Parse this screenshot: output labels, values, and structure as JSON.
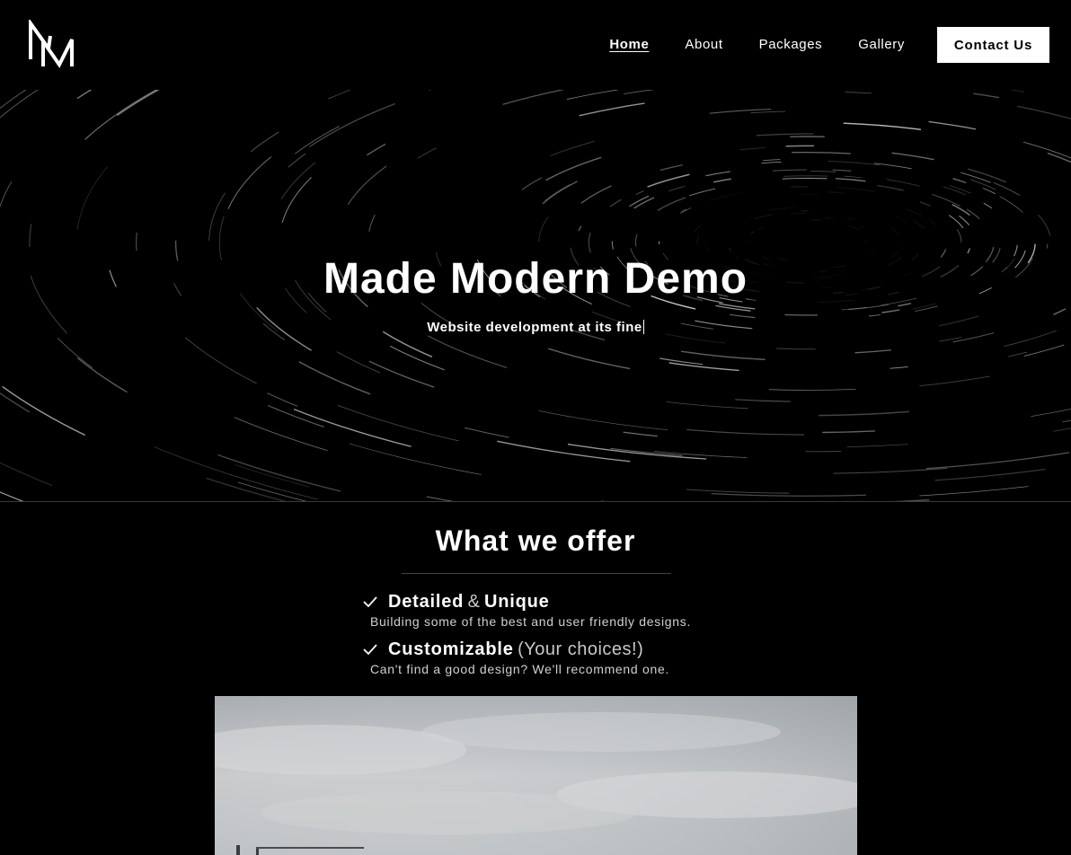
{
  "nav": {
    "links": [
      {
        "label": "Home"
      },
      {
        "label": "About"
      },
      {
        "label": "Packages"
      },
      {
        "label": "Gallery"
      }
    ],
    "cta_label": "Contact Us"
  },
  "hero": {
    "title": "Made Modern Demo",
    "subtitle": "Website development at its fine"
  },
  "offer": {
    "title": "What we offer",
    "items": [
      {
        "title_strong_1": "Detailed",
        "title_light": "&",
        "title_strong_2": "Unique",
        "description": "Building some of the best and user friendly designs."
      },
      {
        "title_strong_1": "Customizable",
        "title_light": "(Your choices!)",
        "title_strong_2": "",
        "description": "Can't find a good design? We'll recommend one."
      }
    ]
  },
  "icons": {
    "logo": "mm-monogram-logo",
    "check": "check-icon"
  },
  "colors": {
    "background": "#000000",
    "text": "#ffffff",
    "button_bg": "#ffffff",
    "button_text": "#000000",
    "muted": "#c8c8c8"
  }
}
